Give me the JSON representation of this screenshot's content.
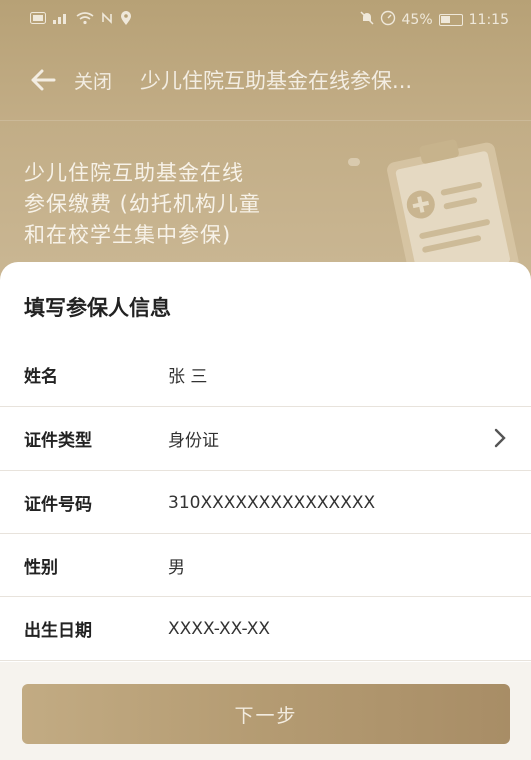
{
  "status_bar": {
    "time": "11:15",
    "battery_percent": "45%"
  },
  "nav": {
    "back_icon": "arrow-left-icon",
    "close_label": "关闭",
    "title": "少儿住院互助基金在线参保..."
  },
  "hero": {
    "line1": "少儿住院互助基金在线",
    "line2": "参保缴费 (幼托机构儿童",
    "line3": "和在校学生集中参保)"
  },
  "form": {
    "title": "填写参保人信息",
    "fields": [
      {
        "label": "姓名",
        "value": "张 三"
      },
      {
        "label": "证件类型",
        "value": "身份证"
      },
      {
        "label": "证件号码",
        "value": "310XXXXXXXXXXXXXXX"
      },
      {
        "label": "性别",
        "value": "男"
      },
      {
        "label": "出生日期",
        "value": "XXXX-XX-XX"
      }
    ]
  },
  "footer": {
    "next_label": "下一步"
  },
  "colors": {
    "brand_gold": "#b7a176",
    "button_gold": "#b49b72"
  }
}
